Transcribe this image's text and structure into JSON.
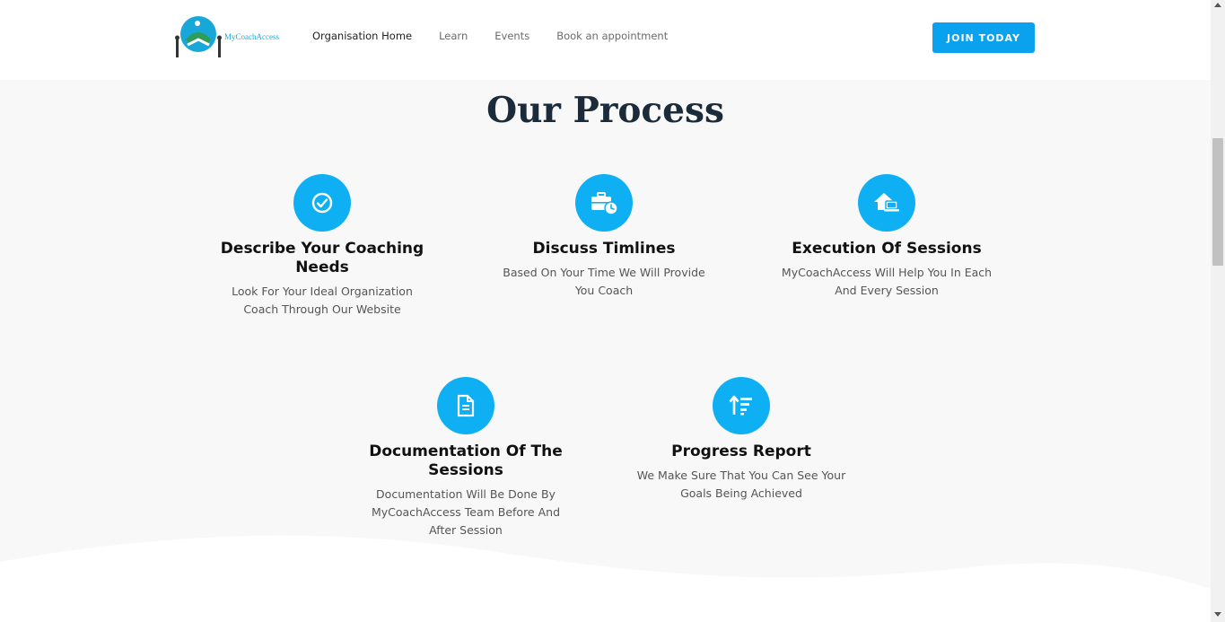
{
  "header": {
    "logo_text": "MyCoachAccess",
    "nav": [
      {
        "label": "Organisation Home",
        "active": true
      },
      {
        "label": "Learn",
        "active": false
      },
      {
        "label": "Events",
        "active": false
      },
      {
        "label": "Book an appointment",
        "active": false
      }
    ],
    "cta_label": "JOIN TODAY"
  },
  "section": {
    "title": "Our Process",
    "steps": [
      {
        "icon": "check-circle-icon",
        "title": "Describe Your Coaching Needs",
        "desc": "Look For Your Ideal Organization Coach Through Our Website"
      },
      {
        "icon": "briefcase-clock-icon",
        "title": "Discuss Timlines",
        "desc": "Based On Your Time We Will Provide You Coach"
      },
      {
        "icon": "home-laptop-icon",
        "title": "Execution Of Sessions",
        "desc": "MyCoachAccess Will Help You In Each And Every Session"
      },
      {
        "icon": "document-icon",
        "title": "Documentation Of The Sessions",
        "desc": "Documentation Will Be Done By MyCoachAccess Team Before And After Session"
      },
      {
        "icon": "sort-amount-up-icon",
        "title": "Progress Report",
        "desc": "We Make Sure That You Can See Your Goals Being Achieved"
      }
    ]
  },
  "colors": {
    "accent": "#0fb0f3",
    "button": "#0aa1ef",
    "title": "#1b2b3a"
  }
}
